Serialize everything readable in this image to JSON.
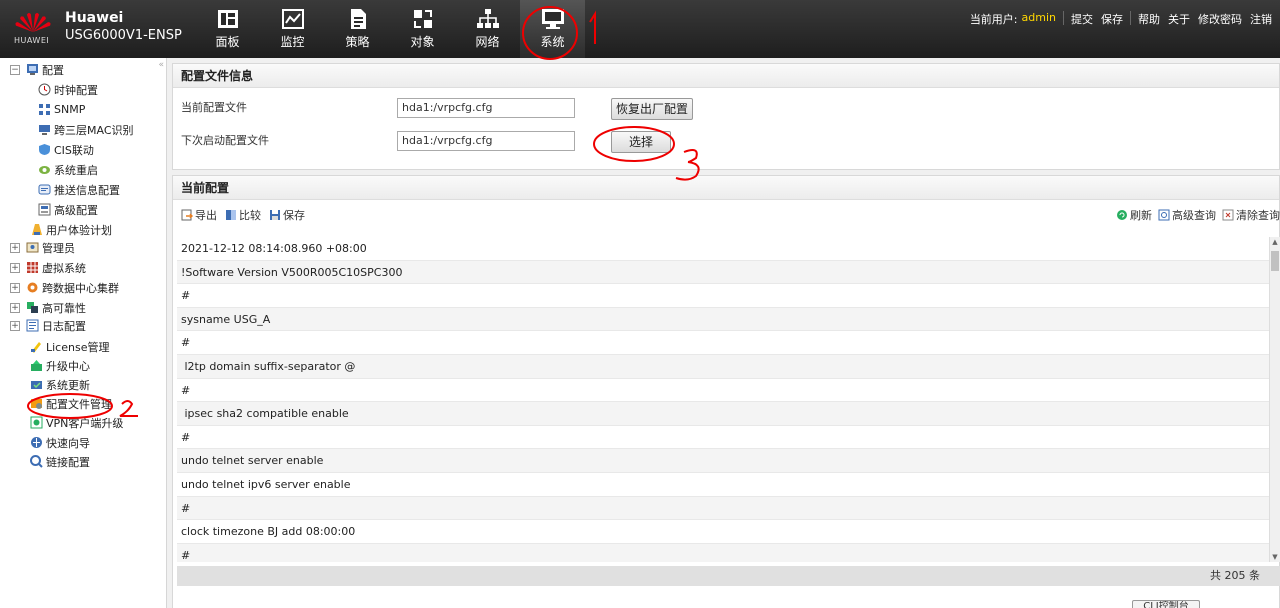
{
  "header": {
    "logo_text": "HUAWEI",
    "brand": "Huawei",
    "model": "USG6000V1-ENSP",
    "nav": [
      {
        "label": "面板",
        "icon": "dashboard-icon"
      },
      {
        "label": "监控",
        "icon": "monitor-chart-icon"
      },
      {
        "label": "策略",
        "icon": "policy-document-icon"
      },
      {
        "label": "对象",
        "icon": "object-icon"
      },
      {
        "label": "网络",
        "icon": "network-icon"
      },
      {
        "label": "系统",
        "icon": "system-monitor-icon"
      }
    ],
    "current_user_label": "当前用户:",
    "current_user": "admin",
    "links": [
      "提交",
      "保存",
      "帮助",
      "关于",
      "修改密码",
      "注销"
    ]
  },
  "sidebar": {
    "collapse_glyph": "«",
    "items": [
      {
        "label": "配置",
        "expander": "−",
        "icon": "config-icon"
      },
      {
        "label": "时钟配置",
        "icon": "clock-icon"
      },
      {
        "label": "SNMP",
        "icon": "snmp-icon"
      },
      {
        "label": "跨三层MAC识别",
        "icon": "mac-icon"
      },
      {
        "label": "CIS联动",
        "icon": "cis-icon"
      },
      {
        "label": "系统重启",
        "icon": "restart-icon"
      },
      {
        "label": "推送信息配置",
        "icon": "push-icon"
      },
      {
        "label": "高级配置",
        "icon": "advanced-icon"
      },
      {
        "label": "用户体验计划",
        "icon": "user-experience-icon"
      },
      {
        "label": "管理员",
        "expander": "+",
        "icon": "admin-icon"
      },
      {
        "label": "虚拟系统",
        "expander": "+",
        "icon": "virtual-system-icon"
      },
      {
        "label": "跨数据中心集群",
        "expander": "+",
        "icon": "cluster-icon"
      },
      {
        "label": "高可靠性",
        "expander": "+",
        "icon": "reliability-icon"
      },
      {
        "label": "日志配置",
        "expander": "+",
        "icon": "log-icon"
      },
      {
        "label": "License管理",
        "icon": "license-icon"
      },
      {
        "label": "升级中心",
        "icon": "upgrade-icon"
      },
      {
        "label": "系统更新",
        "icon": "update-icon"
      },
      {
        "label": "配置文件管理",
        "icon": "config-file-icon"
      },
      {
        "label": "VPN客户端升级",
        "icon": "vpn-icon"
      },
      {
        "label": "快速向导",
        "icon": "wizard-icon"
      },
      {
        "label": "链接配置",
        "icon": "link-icon"
      }
    ]
  },
  "config_info": {
    "title": "配置文件信息",
    "current_file_label": "当前配置文件",
    "current_file_value": "hda1:/vrpcfg.cfg",
    "restore_button": "恢复出厂配置",
    "next_file_label": "下次启动配置文件",
    "next_file_value": "hda1:/vrpcfg.cfg",
    "select_button": "选择"
  },
  "current_config": {
    "title": "当前配置",
    "toolbar_left": [
      "导出",
      "比较",
      "保存"
    ],
    "toolbar_right": [
      "刷新",
      "高级查询",
      "清除查询"
    ],
    "rows": [
      "2021-12-12 08:14:08.960 +08:00",
      "!Software Version V500R005C10SPC300",
      "#",
      "sysname USG_A",
      "#",
      " l2tp domain suffix-separator @",
      "#",
      " ipsec sha2 compatible enable",
      "#",
      "undo telnet server enable",
      "undo telnet ipv6 server enable",
      "#",
      "clock timezone BJ add 08:00:00",
      "#"
    ],
    "total": "共 205 条",
    "cli_button": "CLI控制台"
  },
  "annotations": {
    "mark1": "1",
    "mark2": "2",
    "mark3": "3"
  }
}
